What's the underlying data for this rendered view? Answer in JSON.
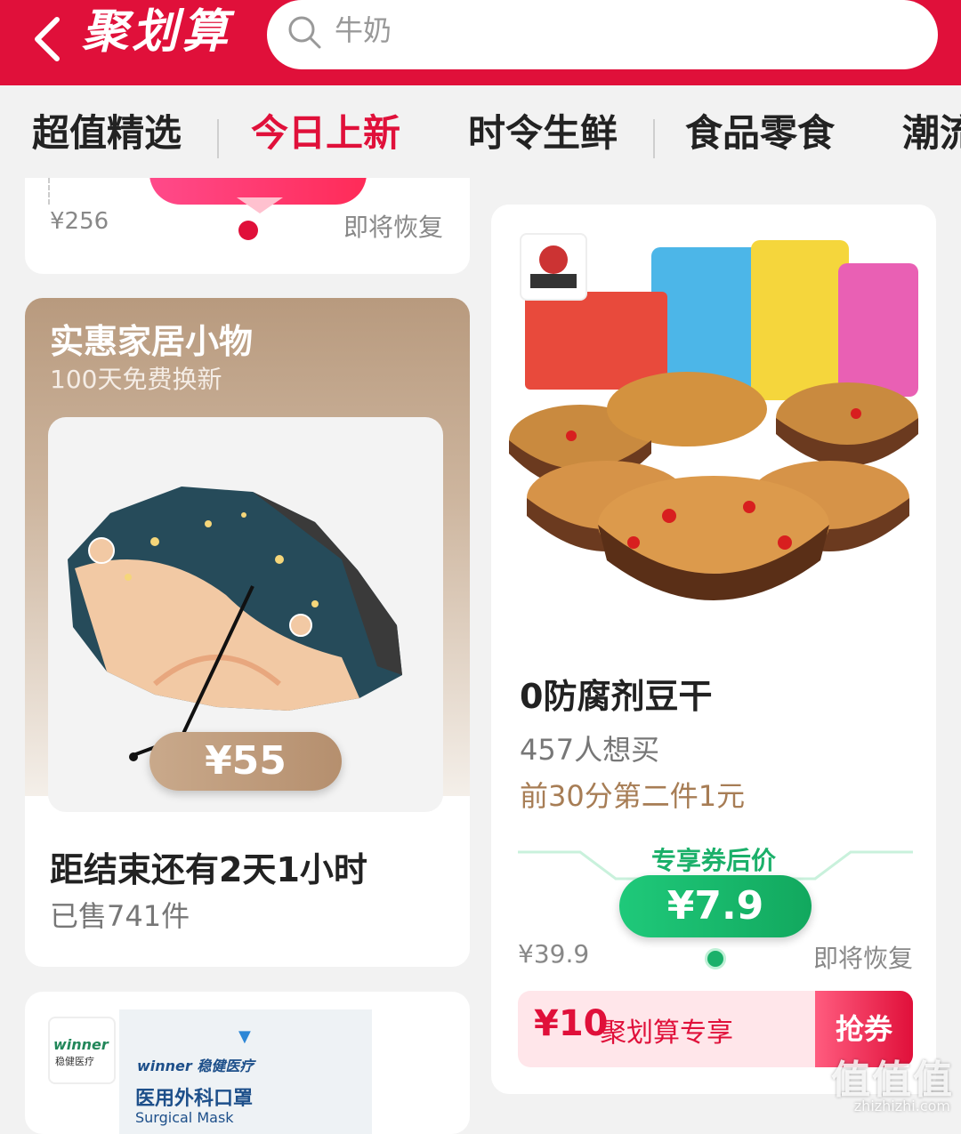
{
  "header": {
    "brand": "聚划算",
    "search_placeholder": "牛奶"
  },
  "tabs": [
    {
      "label": "超值精选"
    },
    {
      "label": "今日上新"
    },
    {
      "label": "时令生鲜"
    },
    {
      "label": "食品零食"
    },
    {
      "label": "潮流"
    }
  ],
  "top_card": {
    "old_price": "¥256",
    "status": "即将恢复"
  },
  "home_card": {
    "title": "实惠家居小物",
    "subtitle": "100天免费换新",
    "price": "¥55",
    "countdown": "距结束还有2天1小时",
    "sold": "已售741件"
  },
  "mask_card": {
    "logo_text": "winner",
    "logo_sub": "稳健医疗",
    "brand": "winner 稳健医疗",
    "title": "医用外科口罩",
    "subtitle": "Surgical Mask"
  },
  "product_card": {
    "name": "0防腐剂豆干",
    "want": "457人想买",
    "promo": "前30分第二件1元",
    "coupon_label": "专享券后价",
    "price": "¥7.9",
    "old_price": "¥39.9",
    "status": "即将恢复",
    "coupon_amount": "¥10",
    "coupon_text": "聚划算专享",
    "grab_label": "抢券"
  },
  "watermark": {
    "text": "值值值",
    "url": "zhizhizhi.com"
  },
  "colors": {
    "brand_red": "#e0103a",
    "green": "#1bb06a",
    "gold": "#b58f6e"
  }
}
